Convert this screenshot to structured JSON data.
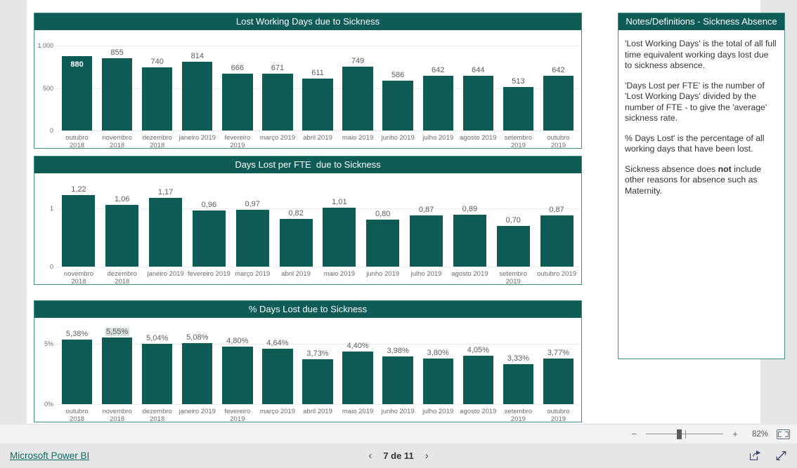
{
  "theme": {
    "accent": "#0e5c55",
    "border": "#3f8f86",
    "label": "#5c5c5c"
  },
  "charts": [
    {
      "id": "lost-working-days",
      "title": "Lost Working Days due to Sickness",
      "type": "bar",
      "ylabel": "",
      "xlabel": "",
      "ylim": [
        0,
        1000
      ],
      "yticks": [
        "1.000",
        "500",
        "0"
      ],
      "ytick_values": [
        1000,
        500,
        0
      ],
      "grid": true,
      "categories": [
        "outubro\n2018",
        "novembro\n2018",
        "dezembro\n2018",
        "janeiro 2019",
        "fevereiro\n2019",
        "março 2019",
        "abril 2019",
        "maio 2019",
        "junho 2019",
        "julho 2019",
        "agosto 2019",
        "setembro\n2019",
        "outubro\n2019"
      ],
      "values": [
        880,
        855,
        740,
        814,
        666,
        671,
        611,
        749,
        586,
        642,
        644,
        513,
        642
      ],
      "labels": [
        "880",
        "855",
        "740",
        "814",
        "666",
        "671",
        "611",
        "749",
        "586",
        "642",
        "644",
        "513",
        "642"
      ],
      "selected_index": 0
    },
    {
      "id": "days-lost-per-fte",
      "title": "Days Lost per FTE  due to Sickness",
      "type": "bar",
      "ylabel": "",
      "xlabel": "",
      "ylim": [
        0,
        1.33
      ],
      "yticks": [
        "1",
        "0"
      ],
      "ytick_values": [
        1,
        0
      ],
      "grid": true,
      "categories": [
        "novembro\n2018",
        "dezembro\n2018",
        "janeiro 2019",
        "fevereiro 2019",
        "março 2019",
        "abril 2019",
        "maio 2019",
        "junho 2019",
        "julho 2019",
        "agosto 2019",
        "setembro\n2019",
        "outubro 2019"
      ],
      "values": [
        1.22,
        1.06,
        1.17,
        0.96,
        0.97,
        0.82,
        1.01,
        0.8,
        0.87,
        0.89,
        0.7,
        0.87
      ],
      "labels": [
        "1,22",
        "1,06",
        "1,17",
        "0,96",
        "0,97",
        "0,82",
        "1,01",
        "0,80",
        "0,87",
        "0,89",
        "0,70",
        "0,87"
      ],
      "selected_index": -1
    },
    {
      "id": "pct-days-lost",
      "title": "% Days Lost due to Sickness",
      "type": "bar",
      "ylabel": "",
      "xlabel": "",
      "ylim": [
        0,
        5.9
      ],
      "yticks": [
        "5%",
        "0%"
      ],
      "ytick_values": [
        5,
        0
      ],
      "grid": true,
      "categories": [
        "outubro\n2018",
        "novembro\n2018",
        "dezembro\n2018",
        "janeiro 2019",
        "fevereiro\n2019",
        "março 2019",
        "abril 2019",
        "maio 2019",
        "junho 2019",
        "julho 2019",
        "agosto 2019",
        "setembro\n2019",
        "outubro\n2019"
      ],
      "values": [
        5.38,
        5.55,
        5.04,
        5.08,
        4.8,
        4.64,
        3.73,
        4.4,
        3.98,
        3.8,
        4.05,
        3.33,
        3.77
      ],
      "labels": [
        "5,38%",
        "5,55%",
        "5,04%",
        "5,08%",
        "4,80%",
        "4,64%",
        "3,73%",
        "4,40%",
        "3,98%",
        "3,80%",
        "4,05%",
        "3,33%",
        "3,77%"
      ],
      "highlight_index": 1
    }
  ],
  "notes": {
    "title": "Notes/Definitions - Sickness Absence",
    "paragraphs": [
      "'Lost Working Days' is the total of all full time equivalent working days lost due to sickness absence.",
      "'Days Lost per FTE' is the number of 'Lost Working Days' divided by the number of FTE - to give the 'average' sickness rate.",
      "% Days Lost' is the percentage of all working days that have been lost."
    ],
    "final_paragraph": {
      "before": "Sickness absence does ",
      "bold": "not",
      "after": " include other reasons for absence such as Maternity."
    }
  },
  "zoombar": {
    "minus": "−",
    "plus": "+",
    "percent": "82%",
    "fit_icon": "fit-to-page-icon"
  },
  "statusbar": {
    "brand": "Microsoft Power BI",
    "prev_icon": "chevron-left-icon",
    "next_icon": "chevron-right-icon",
    "page_label": "7 de 11",
    "share_icon": "share-icon",
    "fullscreen_icon": "fullscreen-icon"
  }
}
